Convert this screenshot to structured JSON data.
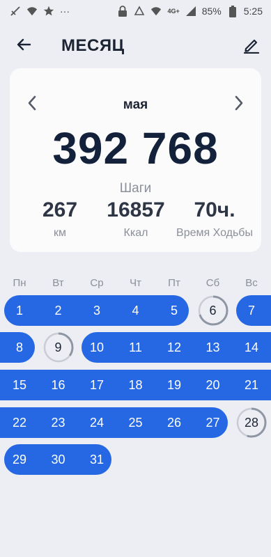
{
  "status_bar": {
    "battery": "85%",
    "time": "5:25",
    "network": "4G+",
    "ellipsis": "···"
  },
  "header": {
    "title": "МЕСЯЦ"
  },
  "summary": {
    "month": "мая",
    "steps_total": "392 768",
    "steps_label": "Шаги",
    "distance_value": "267",
    "distance_unit": "км",
    "calories_value": "16857",
    "calories_unit": "Ккал",
    "time_value": "70ч.",
    "time_label": "Время Ходьбы"
  },
  "calendar": {
    "weekdays": [
      "Пн",
      "Вт",
      "Ср",
      "Чт",
      "Пт",
      "Сб",
      "Вс"
    ],
    "colors": {
      "goal_met": "#2668e3",
      "ring_track": "#c9ccd3",
      "ring_progress": "#8f96a3"
    },
    "days": {
      "d1": "1",
      "d2": "2",
      "d3": "3",
      "d4": "4",
      "d5": "5",
      "d6": "6",
      "d7": "7",
      "d8": "8",
      "d9": "9",
      "d10": "10",
      "d11": "11",
      "d12": "12",
      "d13": "13",
      "d14": "14",
      "d15": "15",
      "d16": "16",
      "d17": "17",
      "d18": "18",
      "d19": "19",
      "d20": "20",
      "d21": "21",
      "d22": "22",
      "d23": "23",
      "d24": "24",
      "d25": "25",
      "d26": "26",
      "d27": "27",
      "d28": "28",
      "d29": "29",
      "d30": "30",
      "d31": "31"
    },
    "partial_progress": {
      "d6": 0.7,
      "d9": 0.35,
      "d28": 0.55
    }
  }
}
